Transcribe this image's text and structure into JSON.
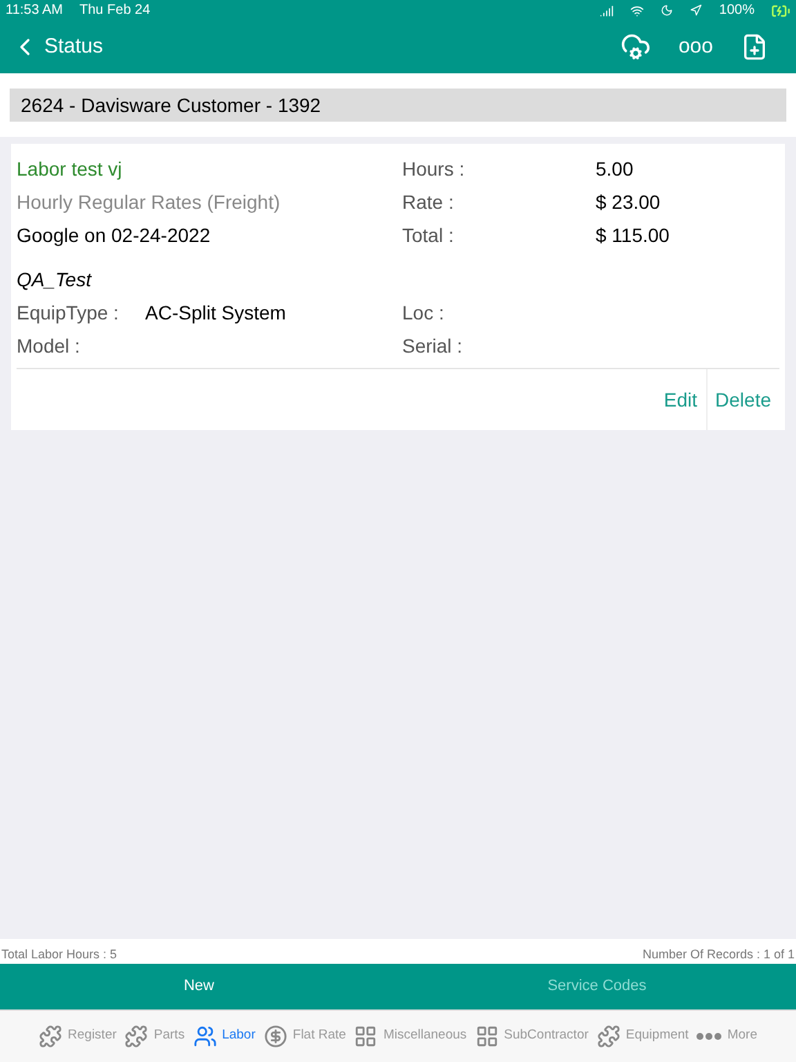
{
  "status_bar": {
    "time": "11:53 AM",
    "date": "Thu Feb 24",
    "battery": "100%"
  },
  "nav": {
    "back": "Status",
    "more": "ooo"
  },
  "customer_header": "2624 - Davisware Customer - 1392",
  "records": [
    {
      "title": "Labor test vj",
      "rate_type": "Hourly Regular Rates (Freight)",
      "entered": "Google on 02-24-2022",
      "fields": [
        {
          "label": "Hours :",
          "value": "5.00"
        },
        {
          "label": "Rate :",
          "value": "$ 23.00"
        },
        {
          "label": "Total :",
          "value": "$ 115.00"
        }
      ],
      "equipment": "QA_Test",
      "equip_type_label": "EquipType :",
      "equip_type": "AC-Split System",
      "loc_label": "Loc :",
      "model_label": "Model :",
      "serial_label": "Serial :",
      "actions": [
        "Edit",
        "Delete"
      ]
    }
  ],
  "footer": {
    "total_hours": "Total Labor Hours :   5",
    "records": "Number Of Records : 1 of 1"
  },
  "action_bar": [
    {
      "label": "New",
      "disabled": false
    },
    {
      "label": "Service Codes",
      "disabled": true
    }
  ],
  "tabs": [
    {
      "label": "Register",
      "kind": "puzzle",
      "selected": false
    },
    {
      "label": "Parts",
      "kind": "puzzle",
      "selected": false
    },
    {
      "label": "Labor",
      "kind": "people",
      "selected": true
    },
    {
      "label": "Flat Rate",
      "kind": "dollar",
      "selected": false
    },
    {
      "label": "Miscellaneous",
      "kind": "grid",
      "selected": false
    },
    {
      "label": "SubContractor",
      "kind": "grid",
      "selected": false
    },
    {
      "label": "Equipment",
      "kind": "puzzle",
      "selected": false
    },
    {
      "label": "More",
      "kind": "dots",
      "selected": false
    }
  ]
}
